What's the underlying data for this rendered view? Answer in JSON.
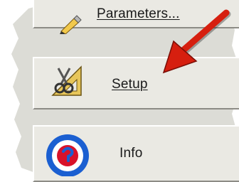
{
  "menu": {
    "items": [
      {
        "label": "Parameters...",
        "icon": "pencil-icon"
      },
      {
        "label": "Setup",
        "icon": "scissors-triangle-icon"
      },
      {
        "label": "Info",
        "icon": "help-circle-icon"
      }
    ]
  },
  "annotation": {
    "icon": "red-arrow-icon"
  },
  "colors": {
    "panel": "#dcdcd6",
    "button_face": "#eae9e3",
    "arrow": "#d61f0f",
    "info_ring": "#1b5fd1",
    "info_inner": "#d8122a"
  }
}
